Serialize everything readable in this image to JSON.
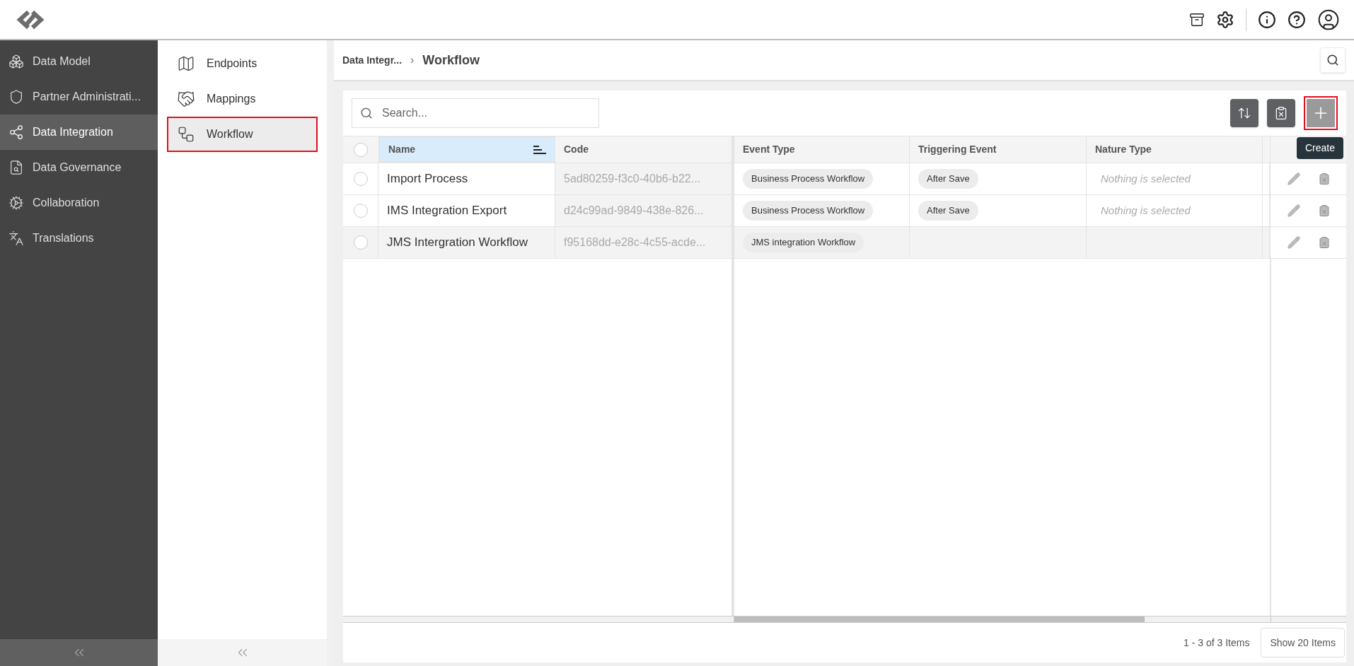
{
  "sidebar": {
    "items": [
      {
        "label": "Data Model",
        "selected": false
      },
      {
        "label": "Partner Administrati...",
        "selected": false
      },
      {
        "label": "Data Integration",
        "selected": true
      },
      {
        "label": "Data Governance",
        "selected": false
      },
      {
        "label": "Collaboration",
        "selected": false
      },
      {
        "label": "Translations",
        "selected": false
      }
    ]
  },
  "subnav": {
    "items": [
      {
        "label": "Endpoints",
        "selected": false
      },
      {
        "label": "Mappings",
        "selected": false
      },
      {
        "label": "Workflow",
        "selected": true
      }
    ]
  },
  "breadcrumb": [
    "Data Integr...",
    "Workflow"
  ],
  "breadcrumb_separator": "›",
  "select_all": {
    "selected": false
  },
  "search": {
    "placeholder": "Search..."
  },
  "tooltip": "Create",
  "table": {
    "columns": [
      {
        "label": "Name",
        "selected": true
      },
      {
        "label": "Code",
        "selected": false
      },
      {
        "label": "Event Type",
        "selected": false
      },
      {
        "label": "Triggering Event",
        "selected": false
      },
      {
        "label": "Nature Type",
        "selected": false
      }
    ],
    "rows": [
      {
        "selected": false,
        "highlighted": false,
        "name": "Import Process",
        "code": "5ad80259-f3c0-40b6-b22...",
        "event_type": "Business Process Workflow",
        "triggering_event": "After Save",
        "nature_type": {
          "placeholder": "Nothing is selected"
        }
      },
      {
        "selected": false,
        "highlighted": false,
        "name": "IMS Integration Export",
        "code": "d24c99ad-9849-438e-826...",
        "event_type": "Business Process Workflow",
        "triggering_event": "After Save",
        "nature_type": {
          "placeholder": "Nothing is selected"
        }
      },
      {
        "selected": false,
        "highlighted": true,
        "name": "JMS Intergration Workflow",
        "code": "f95168dd-e28c-4c55-acde...",
        "event_type": "JMS integration Workflow"
      }
    ]
  },
  "pagination": {
    "summary": "1 - 3 of 3 Items",
    "page_size": "Show 20 Items"
  }
}
